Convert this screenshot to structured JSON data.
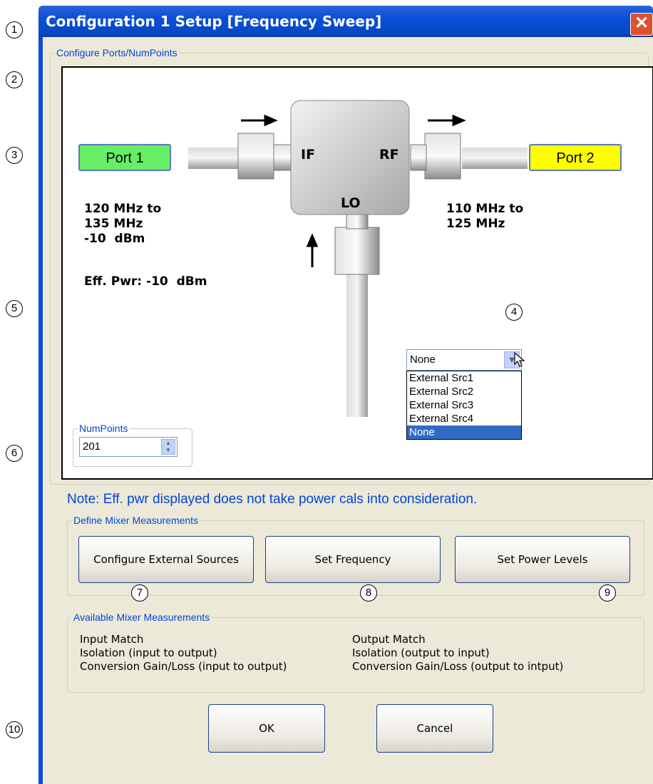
{
  "window": {
    "title": "Configuration 1 Setup [Frequency Sweep]",
    "close_glyph": "✕"
  },
  "callouts": [
    "1",
    "2",
    "3",
    "5",
    "6",
    "10",
    "4",
    "7",
    "8",
    "9"
  ],
  "ports_group": {
    "legend": "Configure Ports/NumPoints",
    "port1": {
      "label": "Port 1",
      "color": "#66ee66"
    },
    "port2": {
      "label": "Port 2",
      "color": "#ffff00"
    },
    "port1_info": "120 MHz to\n135 MHz\n-10  dBm",
    "port1_eff_pwr": "Eff. Pwr: -10  dBm",
    "port2_info": "110 MHz to\n125 MHz",
    "mixer": {
      "if_label": "IF",
      "rf_label": "RF",
      "lo_label": "LO"
    },
    "lo_source": {
      "selected": "None",
      "arrow_icon": "chevron-down-icon",
      "options": [
        "External Src1",
        "External Src2",
        "External Src3",
        "External Src4",
        "None"
      ]
    },
    "numpoints": {
      "legend": "NumPoints",
      "value": "201"
    }
  },
  "note": "Note: Eff. pwr displayed does not take power cals into consideration.",
  "define_group": {
    "legend": "Define Mixer Measurements",
    "buttons": {
      "configure_external": "Configure External Sources",
      "set_frequency": "Set Frequency",
      "set_power": "Set Power Levels"
    }
  },
  "available_group": {
    "legend": "Available Mixer Measurements",
    "left": [
      "Input Match",
      "Isolation (input to output)",
      "Conversion Gain/Loss (input to output)"
    ],
    "right": [
      "Output Match",
      "Isolation (output to input)",
      "Conversion Gain/Loss (output to intput)"
    ]
  },
  "footer": {
    "ok": "OK",
    "cancel": "Cancel"
  }
}
